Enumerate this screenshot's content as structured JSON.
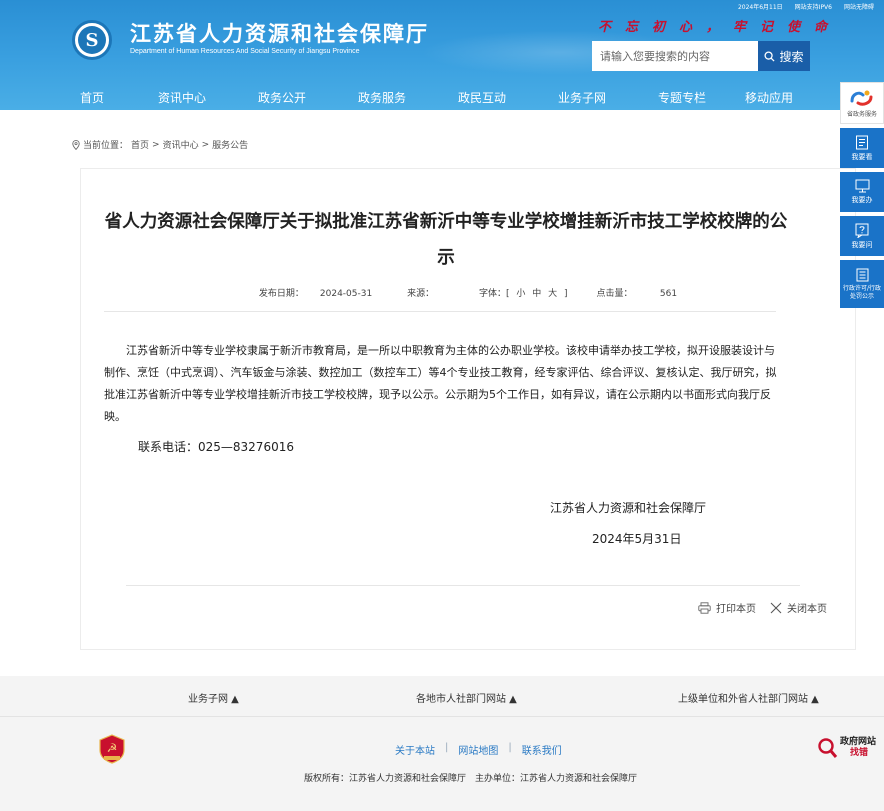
{
  "topbar": {
    "date": "2024年6月11日",
    "ipv6": "网站支持IPV6",
    "accessibility": "网站无障碍"
  },
  "header": {
    "title": "江苏省人力资源和社会保障厅",
    "subtitle": "Department of Human Resources And Social Security of Jiangsu Province",
    "slogan": "不忘初心，牢记使命",
    "search_placeholder": "请输入您要搜索的内容",
    "search_label": "搜索"
  },
  "nav": {
    "items": [
      {
        "label": "首页"
      },
      {
        "label": "资讯中心"
      },
      {
        "label": "政务公开"
      },
      {
        "label": "政务服务"
      },
      {
        "label": "政民互动"
      },
      {
        "label": "业务子网"
      },
      {
        "label": "专题专栏"
      },
      {
        "label": "移动应用"
      }
    ]
  },
  "breadcrumb": {
    "prefix": "当前位置：",
    "items": [
      "首页",
      "资讯中心",
      "服务公告"
    ],
    "sep": ">"
  },
  "article": {
    "title": "省人力资源社会保障厅关于拟批准江苏省新沂中等专业学校增挂新沂市技工学校校牌的公示",
    "meta": {
      "date_label": "发布日期：",
      "date": "2024-05-31",
      "source_label": "来源：",
      "source": "",
      "font_label": "字体：[",
      "font_small": "小",
      "font_medium": "中",
      "font_large": "大",
      "font_close": "]",
      "clicks_label": "点击量：",
      "clicks": "561"
    },
    "body": "江苏省新沂中等专业学校隶属于新沂市教育局，是一所以中职教育为主体的公办职业学校。该校申请举办技工学校，拟开设服装设计与制作、烹饪（中式烹调）、汽车钣金与涂装、数控加工（数控车工）等4个专业技工教育，经专家评估、综合评议、复核认定、我厅研究，拟批准江苏省新沂中等专业学校增挂新沂市技工学校校牌，现予以公示。公示期为5个工作日，如有异议，请在公示期内以书面形式向我厅反映。",
    "contact": "联系电话：025—83276016",
    "org": "江苏省人力资源和社会保障厅",
    "date": "2024年5月31日",
    "print_label": "打印本页",
    "close_label": "关闭本页"
  },
  "side": {
    "top_label": "省政务服务",
    "buttons": [
      {
        "label": "我要看"
      },
      {
        "label": "我要办"
      },
      {
        "label": "我要问"
      },
      {
        "label": "行政许可/行政处罚公示"
      }
    ]
  },
  "footer": {
    "links": [
      "业务子网 ▲",
      "各地市人社部门网站 ▲",
      "上级单位和外省人社部门网站 ▲"
    ],
    "nav": [
      "关于本站",
      "网站地图",
      "联系我们"
    ],
    "nav_sep": "|",
    "copyright": "版权所有：江苏省人力资源和社会保障厅　主办单位：江苏省人力资源和社会保障厅",
    "jc_line1": "政府网站",
    "jc_line2": "找错"
  },
  "colors": {
    "header_blue": "#3aa0e0",
    "search_btn": "#1a5ea8",
    "side_btn": "#1a73c8",
    "slogan_red": "#c8102e",
    "footer_link": "#2a7ac4"
  }
}
